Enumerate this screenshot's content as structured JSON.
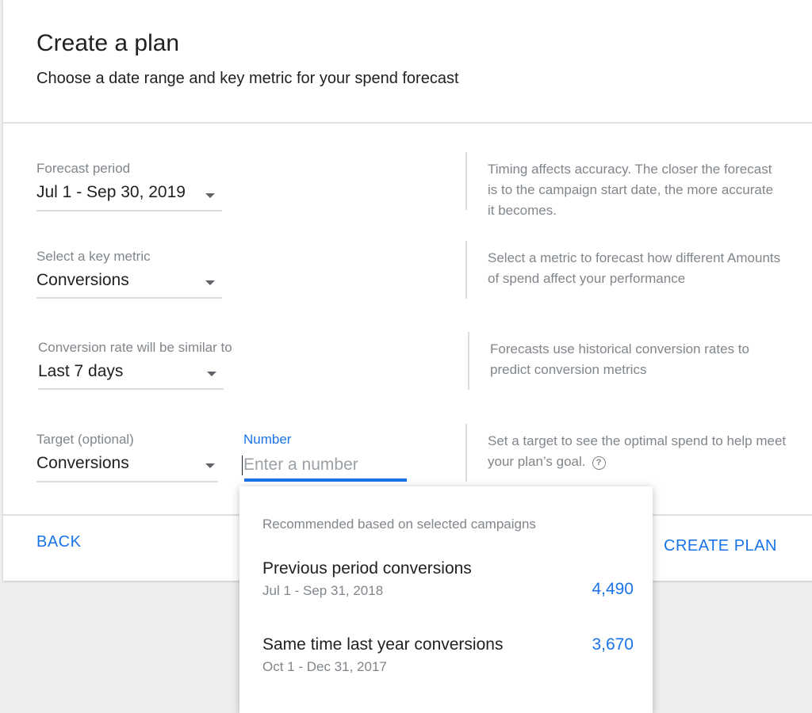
{
  "dialog": {
    "title": "Create a plan",
    "subtitle": "Choose a date range and key metric for your spend forecast"
  },
  "fields": {
    "forecast_period": {
      "label": "Forecast period",
      "value": "Jul 1 - Sep 30, 2019",
      "help": "Timing affects accuracy. The closer the forecast is to the campaign start date, the more accurate it becomes."
    },
    "key_metric": {
      "label": "Select a key metric",
      "value": "Conversions",
      "help": "Select a metric to forecast how different Amounts of spend affect your performance"
    },
    "conversion_rate": {
      "label": "Conversion rate will be similar to",
      "value": "Last 7 days",
      "help": "Forecasts use historical conversion rates to predict conversion metrics"
    },
    "target": {
      "label": "Target (optional)",
      "value": "Conversions",
      "help": "Set a target to see the optimal spend to help meet your plan’s goal.",
      "help_icon": "help-circle-icon"
    },
    "number": {
      "label": "Number",
      "placeholder": "Enter a number",
      "value": ""
    }
  },
  "dropdown": {
    "header": "Recommended based on selected campaigns",
    "items": [
      {
        "title": "Previous period conversions",
        "subtitle": "Jul 1 - Sep 31, 2018",
        "value": "4,490"
      },
      {
        "title": "Same time last year conversions",
        "subtitle": "Oct 1 - Dec 31, 2017",
        "value": "3,670"
      }
    ]
  },
  "footer": {
    "back_label": "BACK",
    "create_label": "CREATE PLAN"
  },
  "colors": {
    "accent": "#1a73e8",
    "text_primary": "#202124",
    "text_secondary": "#80868b",
    "divider": "#dadce0",
    "background": "#eeeeee"
  }
}
